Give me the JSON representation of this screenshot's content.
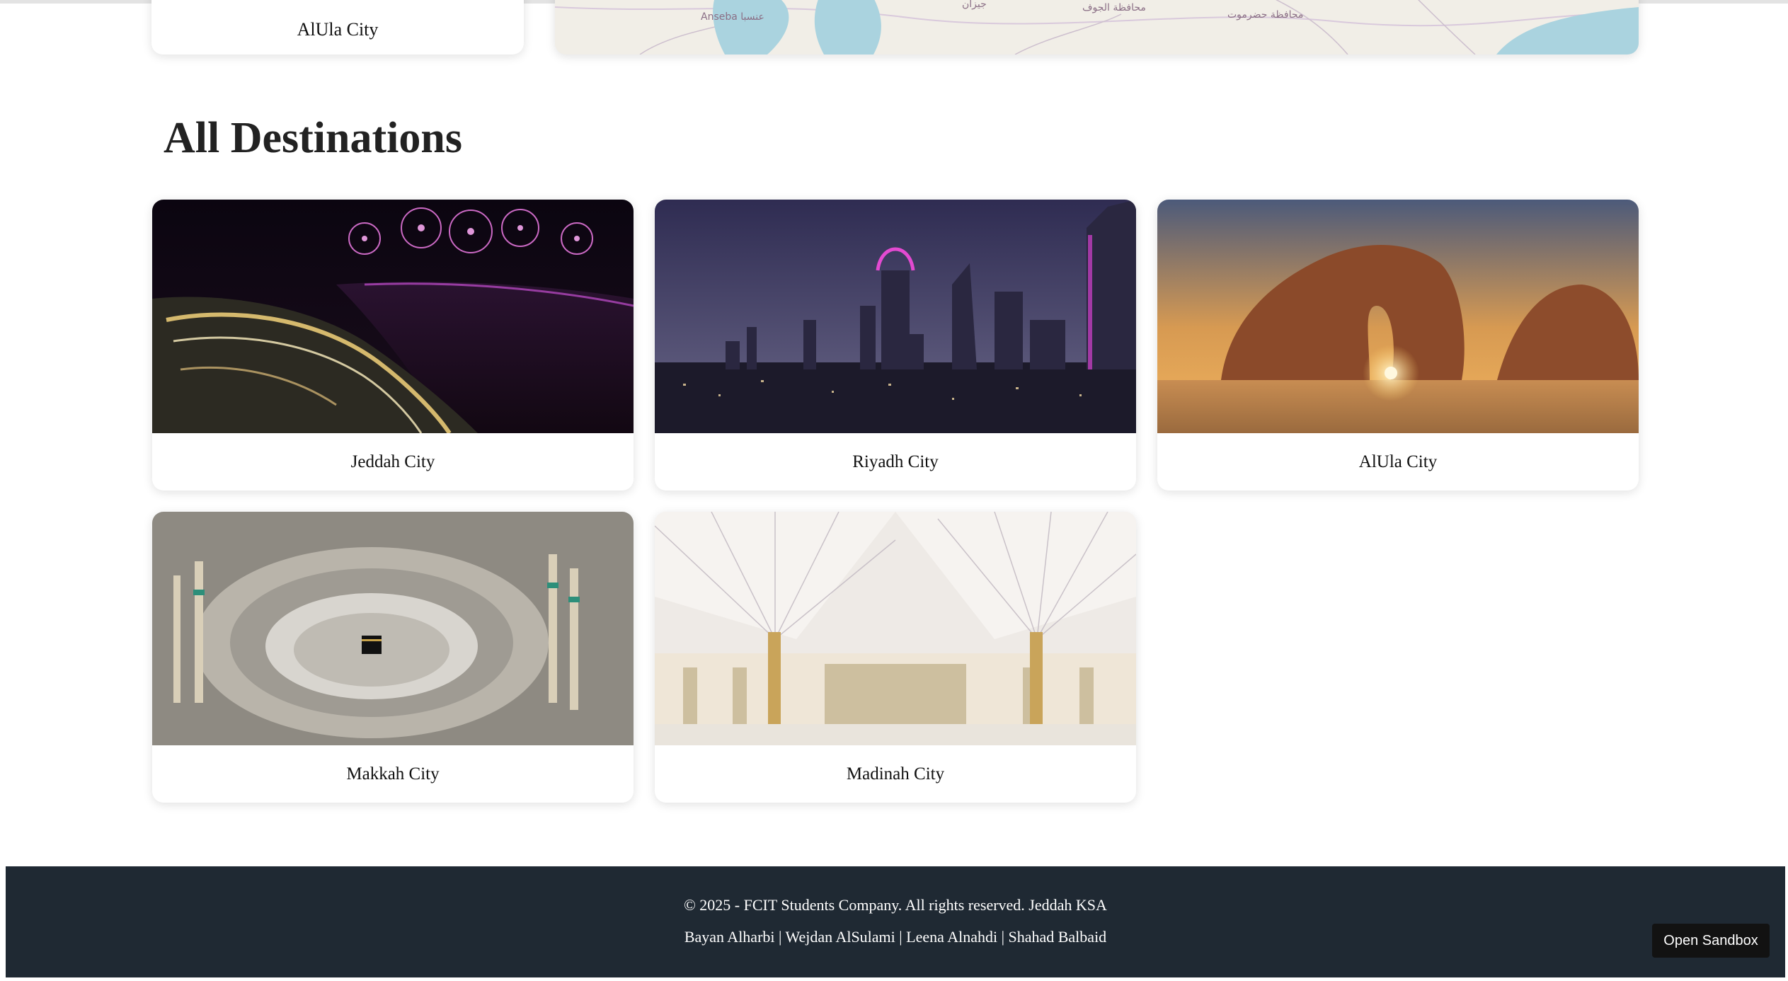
{
  "top_row": {
    "card_label": "AlUla City",
    "map_labels": [
      "محافظة الجوف",
      "محافظة حضرموت",
      "Anseba عنسبا",
      "جيزان"
    ]
  },
  "section": {
    "title": "All Destinations"
  },
  "destinations": [
    {
      "label": "Jeddah City"
    },
    {
      "label": "Riyadh City"
    },
    {
      "label": "AlUla City"
    },
    {
      "label": "Makkah City"
    },
    {
      "label": "Madinah City"
    }
  ],
  "footer": {
    "copyright": "© 2025 - FCIT Students Company. All rights reserved. Jeddah KSA",
    "authors": "Bayan Alharbi | Wejdan AlSulami | Leena Alnahdi | Shahad Balbaid"
  },
  "sandbox": {
    "label": "Open Sandbox"
  },
  "colors": {
    "footer_bg": "#1f2933",
    "button_bg": "#121212",
    "map_water": "#aad3df",
    "map_land": "#f1eee7"
  }
}
